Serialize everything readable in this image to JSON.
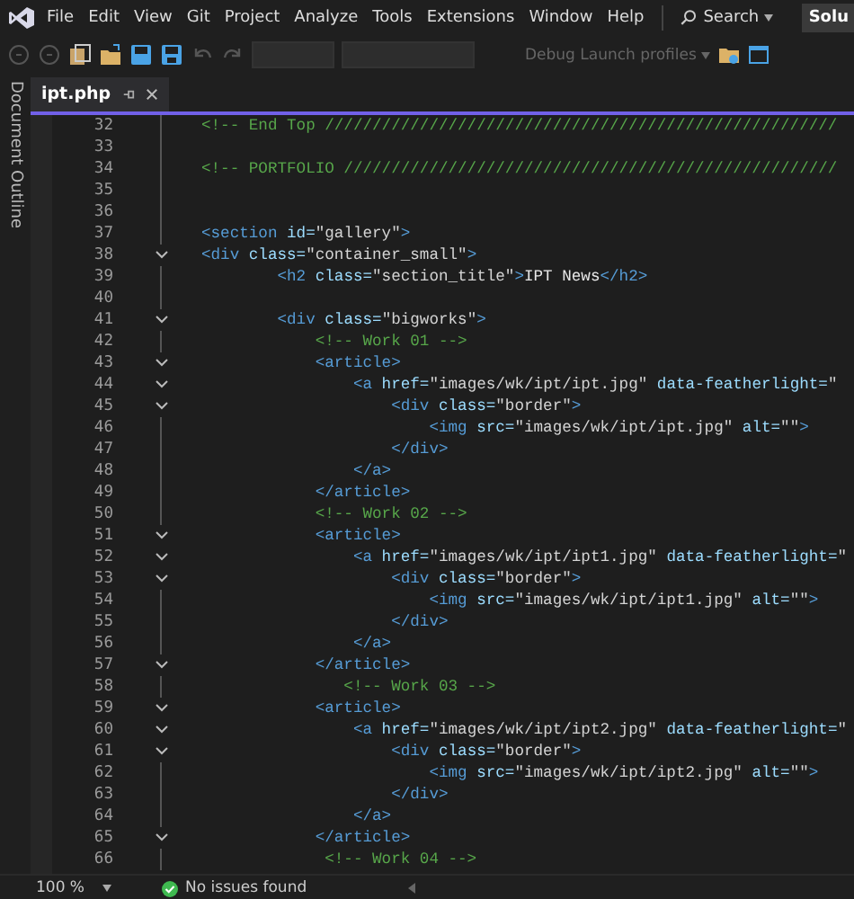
{
  "menu": {
    "items": [
      "File",
      "Edit",
      "View",
      "Git",
      "Project",
      "Analyze",
      "Tools",
      "Extensions",
      "Window",
      "Help"
    ],
    "search": "Search",
    "solution_button": "Solu"
  },
  "toolbar": {
    "debug_profiles": "Debug Launch profiles"
  },
  "side_panel": {
    "label": "Document Outline"
  },
  "tabs": [
    {
      "label": "ipt.php",
      "selected": true
    }
  ],
  "editor": {
    "lines": [
      {
        "number": "32",
        "foldable": false,
        "tokens": [
          {
            "kind": "comment",
            "text": "<!-- End Top //////////////////////////////////////////////////////"
          }
        ]
      },
      {
        "number": "33",
        "foldable": false
      },
      {
        "number": "34",
        "foldable": false,
        "tokens": [
          {
            "kind": "comment",
            "text": "<!-- PORTFOLIO ////////////////////////////////////////////////////"
          }
        ]
      },
      {
        "number": "35",
        "foldable": false
      },
      {
        "number": "36",
        "foldable": false
      },
      {
        "number": "37",
        "foldable": false,
        "tokens": [
          {
            "kind": "tag",
            "text": "<section"
          },
          {
            "kind": "attr",
            "text": " id="
          },
          {
            "kind": "string",
            "text": "\"gallery\""
          },
          {
            "kind": "tag",
            "text": ">"
          }
        ]
      },
      {
        "number": "38",
        "foldable": true,
        "tokens": [
          {
            "kind": "tag",
            "text": "<div"
          },
          {
            "kind": "attr",
            "text": " class="
          },
          {
            "kind": "string",
            "text": "\"container_small\""
          },
          {
            "kind": "tag",
            "text": ">"
          }
        ]
      },
      {
        "number": "39",
        "foldable": false,
        "tokens": [
          {
            "kind": "tag",
            "text": "        <h2"
          },
          {
            "kind": "attr",
            "text": " class="
          },
          {
            "kind": "string",
            "text": "\"section_title\""
          },
          {
            "kind": "tag",
            "text": ">"
          },
          {
            "kind": "text",
            "text": "IPT News"
          },
          {
            "kind": "tag",
            "text": "</h2>"
          }
        ]
      },
      {
        "number": "40",
        "foldable": false
      },
      {
        "number": "41",
        "foldable": true,
        "tokens": [
          {
            "kind": "tag",
            "text": "        <div"
          },
          {
            "kind": "attr",
            "text": " class="
          },
          {
            "kind": "string",
            "text": "\"bigworks\""
          },
          {
            "kind": "tag",
            "text": ">"
          }
        ]
      },
      {
        "number": "42",
        "foldable": false,
        "tokens": [
          {
            "kind": "comment",
            "text": "            <!-- Work 01 -->"
          }
        ]
      },
      {
        "number": "43",
        "foldable": true,
        "tokens": [
          {
            "kind": "tag",
            "text": "            <article>"
          }
        ]
      },
      {
        "number": "44",
        "foldable": true,
        "tokens": [
          {
            "kind": "tag",
            "text": "                <a"
          },
          {
            "kind": "attr",
            "text": " href="
          },
          {
            "kind": "string",
            "text": "\"images/wk/ipt/ipt.jpg\""
          },
          {
            "kind": "attr",
            "text": " data-featherlight="
          },
          {
            "kind": "string",
            "text": "\""
          }
        ]
      },
      {
        "number": "45",
        "foldable": true,
        "tokens": [
          {
            "kind": "tag",
            "text": "                    <div"
          },
          {
            "kind": "attr",
            "text": " class="
          },
          {
            "kind": "string",
            "text": "\"border\""
          },
          {
            "kind": "tag",
            "text": ">"
          }
        ]
      },
      {
        "number": "46",
        "foldable": false,
        "tokens": [
          {
            "kind": "tag",
            "text": "                        <img"
          },
          {
            "kind": "attr",
            "text": " src="
          },
          {
            "kind": "string",
            "text": "\"images/wk/ipt/ipt.jpg\""
          },
          {
            "kind": "attr",
            "text": " alt="
          },
          {
            "kind": "string",
            "text": "\"\""
          },
          {
            "kind": "tag",
            "text": ">"
          }
        ]
      },
      {
        "number": "47",
        "foldable": false,
        "tokens": [
          {
            "kind": "tag",
            "text": "                    </div>"
          }
        ]
      },
      {
        "number": "48",
        "foldable": false,
        "tokens": [
          {
            "kind": "tag",
            "text": "                </a>"
          }
        ]
      },
      {
        "number": "49",
        "foldable": false,
        "tokens": [
          {
            "kind": "tag",
            "text": "            </article>"
          }
        ]
      },
      {
        "number": "50",
        "foldable": false,
        "tokens": [
          {
            "kind": "comment",
            "text": "            <!-- Work 02 -->"
          }
        ]
      },
      {
        "number": "51",
        "foldable": true,
        "tokens": [
          {
            "kind": "tag",
            "text": "            <article>"
          }
        ]
      },
      {
        "number": "52",
        "foldable": true,
        "tokens": [
          {
            "kind": "tag",
            "text": "                <a"
          },
          {
            "kind": "attr",
            "text": " href="
          },
          {
            "kind": "string",
            "text": "\"images/wk/ipt/ipt1.jpg\""
          },
          {
            "kind": "attr",
            "text": " data-featherlight="
          },
          {
            "kind": "string",
            "text": "\""
          }
        ]
      },
      {
        "number": "53",
        "foldable": true,
        "tokens": [
          {
            "kind": "tag",
            "text": "                    <div"
          },
          {
            "kind": "attr",
            "text": " class="
          },
          {
            "kind": "string",
            "text": "\"border\""
          },
          {
            "kind": "tag",
            "text": ">"
          }
        ]
      },
      {
        "number": "54",
        "foldable": false,
        "tokens": [
          {
            "kind": "tag",
            "text": "                        <img"
          },
          {
            "kind": "attr",
            "text": " src="
          },
          {
            "kind": "string",
            "text": "\"images/wk/ipt/ipt1.jpg\""
          },
          {
            "kind": "attr",
            "text": " alt="
          },
          {
            "kind": "string",
            "text": "\"\""
          },
          {
            "kind": "tag",
            "text": ">"
          }
        ]
      },
      {
        "number": "55",
        "foldable": false,
        "tokens": [
          {
            "kind": "tag",
            "text": "                    </div>"
          }
        ]
      },
      {
        "number": "56",
        "foldable": false,
        "tokens": [
          {
            "kind": "tag",
            "text": "                </a>"
          }
        ]
      },
      {
        "number": "57",
        "foldable": true,
        "tokens": [
          {
            "kind": "tag",
            "text": "            </article>"
          }
        ]
      },
      {
        "number": "58",
        "foldable": false,
        "tokens": [
          {
            "kind": "comment",
            "text": "               <!-- Work 03 -->"
          }
        ]
      },
      {
        "number": "59",
        "foldable": true,
        "tokens": [
          {
            "kind": "tag",
            "text": "            <article>"
          }
        ]
      },
      {
        "number": "60",
        "foldable": true,
        "tokens": [
          {
            "kind": "tag",
            "text": "                <a"
          },
          {
            "kind": "attr",
            "text": " href="
          },
          {
            "kind": "string",
            "text": "\"images/wk/ipt/ipt2.jpg\""
          },
          {
            "kind": "attr",
            "text": " data-featherlight="
          },
          {
            "kind": "string",
            "text": "\""
          }
        ]
      },
      {
        "number": "61",
        "foldable": true,
        "tokens": [
          {
            "kind": "tag",
            "text": "                    <div"
          },
          {
            "kind": "attr",
            "text": " class="
          },
          {
            "kind": "string",
            "text": "\"border\""
          },
          {
            "kind": "tag",
            "text": ">"
          }
        ]
      },
      {
        "number": "62",
        "foldable": false,
        "tokens": [
          {
            "kind": "tag",
            "text": "                        <img"
          },
          {
            "kind": "attr",
            "text": " src="
          },
          {
            "kind": "string",
            "text": "\"images/wk/ipt/ipt2.jpg\""
          },
          {
            "kind": "attr",
            "text": " alt="
          },
          {
            "kind": "string",
            "text": "\"\""
          },
          {
            "kind": "tag",
            "text": ">"
          }
        ]
      },
      {
        "number": "63",
        "foldable": false,
        "tokens": [
          {
            "kind": "tag",
            "text": "                    </div>"
          }
        ]
      },
      {
        "number": "64",
        "foldable": false,
        "tokens": [
          {
            "kind": "tag",
            "text": "                </a>"
          }
        ]
      },
      {
        "number": "65",
        "foldable": true,
        "tokens": [
          {
            "kind": "tag",
            "text": "            </article>"
          }
        ]
      },
      {
        "number": "66",
        "foldable": false,
        "tokens": [
          {
            "kind": "comment",
            "text": "             <!-- Work 04 -->"
          }
        ]
      }
    ]
  },
  "status_bar": {
    "zoom": "100 %",
    "issues": "No issues found"
  }
}
